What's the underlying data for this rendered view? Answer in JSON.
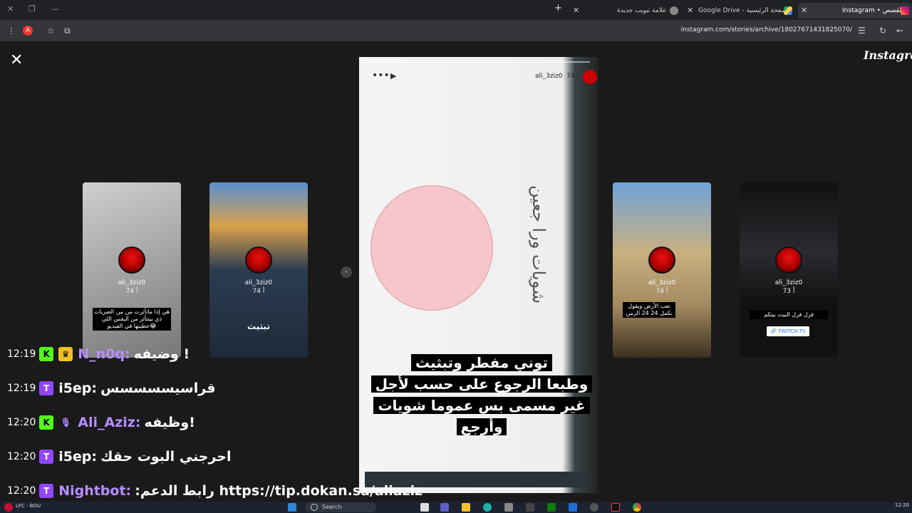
{
  "browser": {
    "tabs": [
      {
        "title": "Instagram • القصص",
        "active": true
      },
      {
        "title": "Google Drive - الصفحة الرئيسية",
        "active": false
      },
      {
        "title": "علامة تبويب جديدة",
        "active": false
      }
    ],
    "new_tab": "+",
    "url": "instagram.com/stories/archive/18027671431825070/"
  },
  "page": {
    "logo": "Instagram",
    "close": "✕",
    "nav_prev": "‹",
    "nav_next": "›"
  },
  "story": {
    "username": "ali_3ziz0",
    "ago": "74 أ",
    "menu": "•••",
    "play": "▶",
    "handwriting": "شويات ورا جعين",
    "subtitle_lines": [
      "توني مفطر وتبثيث",
      "وطبعا الرجوع على حسب لأجل",
      "غير مسمى بس عموما شويات",
      "وأرجع"
    ],
    "progress": 0.16
  },
  "cards": [
    {
      "username": "ali_3ziz0",
      "ago": "74 أ",
      "caption": "هي إذا ماتأثرت من من الضربات ذي بيتتأثر من البقس اللي عطيتها في الفيديو😂"
    },
    {
      "username": "ali_3ziz0",
      "ago": "74 أ",
      "caption": "تبثيث"
    },
    {
      "username": "ali_3ziz0",
      "ago": "74 أ",
      "caption": "تعب الأرض ويقول بكمل 24 24 الزمن"
    },
    {
      "username": "ali_3ziz0",
      "ago": "73 أ",
      "caption": "فزل فزل البيت بيتكم",
      "link": "🔗 TWITCH.TV"
    }
  ],
  "chat": [
    {
      "time": "12:19",
      "badges": [
        "K",
        "♛"
      ],
      "user": "N_n0q:",
      "text": "وضيفه !",
      "user_color": "#b68cff"
    },
    {
      "time": "12:19",
      "badges": [
        "T"
      ],
      "user": "i5ep:",
      "text": "قراسيسسسسس",
      "user_color": "#ffffff"
    },
    {
      "time": "12:20",
      "badges": [
        "K",
        "🎙"
      ],
      "user": "Ali_Aziz:",
      "text": "وظيفه!",
      "user_color": "#b68cff"
    },
    {
      "time": "12:20",
      "badges": [
        "T"
      ],
      "user": "i5ep:",
      "text": "احرجني البوت حقك",
      "user_color": "#ffffff"
    },
    {
      "time": "12:20",
      "badges": [
        "T"
      ],
      "user": "Nightbot:",
      "text": ":رابط الدعم https://tip.dokan.sa/aliaziz",
      "user_color": "#b68cff"
    }
  ],
  "taskbar": {
    "weather": "LFC - BOU",
    "search": "Search",
    "clock": "12:20"
  },
  "colors": {
    "badge_kick": "#53fc18",
    "badge_twitch": "#9146ff",
    "accent": "#b68cff"
  }
}
